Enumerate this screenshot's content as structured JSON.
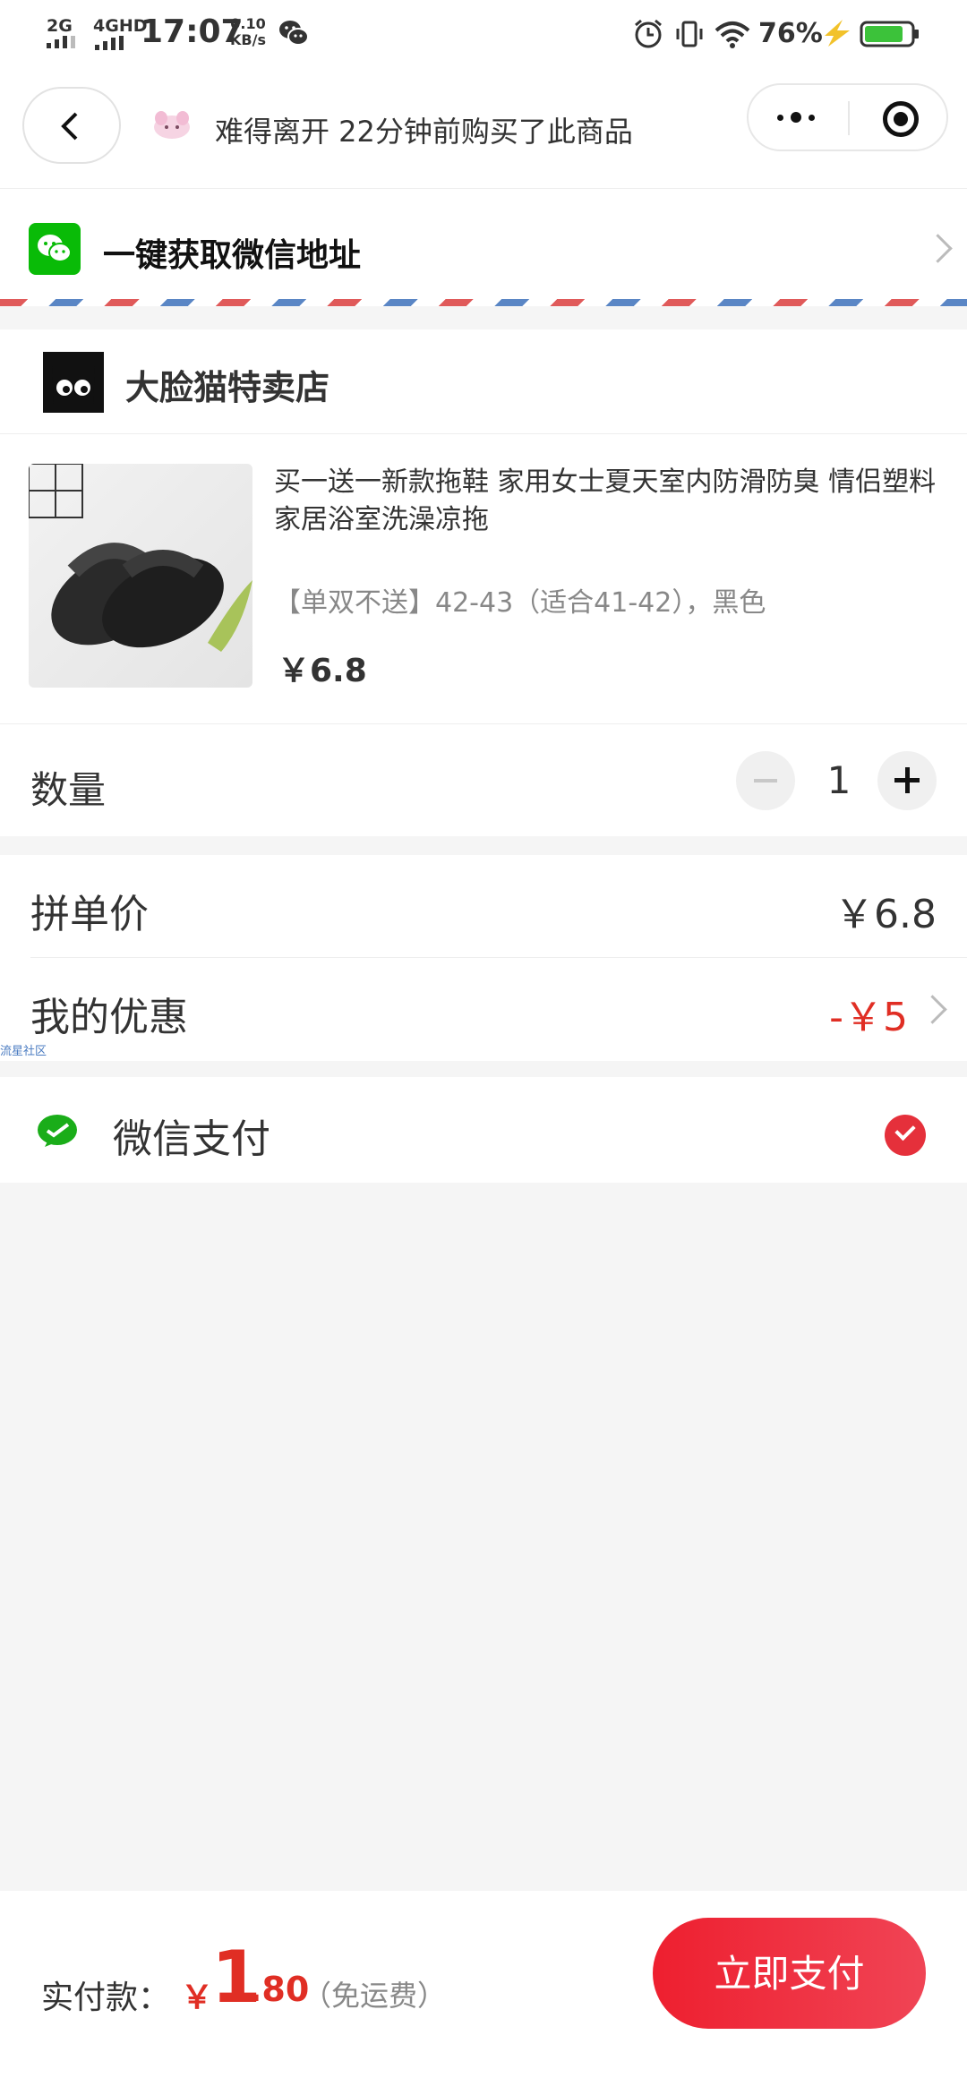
{
  "status_bar": {
    "network1": "2G",
    "network2": "4GHD",
    "time": "17:07",
    "speed_value": "0.10",
    "speed_unit": "KB/s",
    "battery_percent": "76%"
  },
  "nav": {
    "notice": "难得离开 22分钟前购买了此商品"
  },
  "address": {
    "label": "一键获取微信地址"
  },
  "shop": {
    "name": "大脸猫特卖店"
  },
  "product": {
    "title": "买一送一新款拖鞋 家用女士夏天室内防滑防臭 情侣塑料家居浴室洗澡凉拖",
    "spec": "【单双不送】42-43（适合41-42），黑色",
    "price": "￥6.8"
  },
  "quantity": {
    "label": "数量",
    "value": "1"
  },
  "prices": {
    "group_price_label": "拼单价",
    "group_price_value": "￥6.8",
    "discount_label": "我的优惠",
    "discount_value": "-￥5"
  },
  "watermark": "流星社区",
  "payment": {
    "method_label": "微信支付",
    "selected": true
  },
  "footer": {
    "total_label": "实付款：",
    "currency": "￥",
    "amount_int": "1",
    "amount_dec": ".80",
    "shipping_note": "（免运费）",
    "submit_label": "立即支付"
  },
  "colors": {
    "accent_red": "#e02e24",
    "wechat_green": "#09bb07"
  }
}
